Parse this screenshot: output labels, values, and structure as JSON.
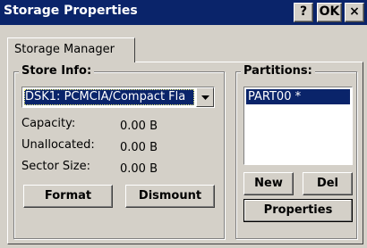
{
  "window": {
    "title": "Storage Properties",
    "help_label": "?",
    "ok_label": "OK",
    "close_label": "×"
  },
  "tabs": [
    {
      "label": "Storage Manager"
    }
  ],
  "store_info": {
    "label": "Store Info:",
    "selected_store": "DSK1: PCMCIA/Compact Fla",
    "fields": [
      {
        "label": "Capacity:",
        "value": "0.00 B"
      },
      {
        "label": "Unallocated:",
        "value": "0.00 B"
      },
      {
        "label": "Sector Size:",
        "value": "0.00 B"
      }
    ],
    "format_label": "Format",
    "dismount_label": "Dismount"
  },
  "partitions": {
    "label": "Partitions:",
    "items": [
      "PART00 *"
    ],
    "new_label": "New",
    "del_label": "Del",
    "properties_label": "Properties"
  }
}
